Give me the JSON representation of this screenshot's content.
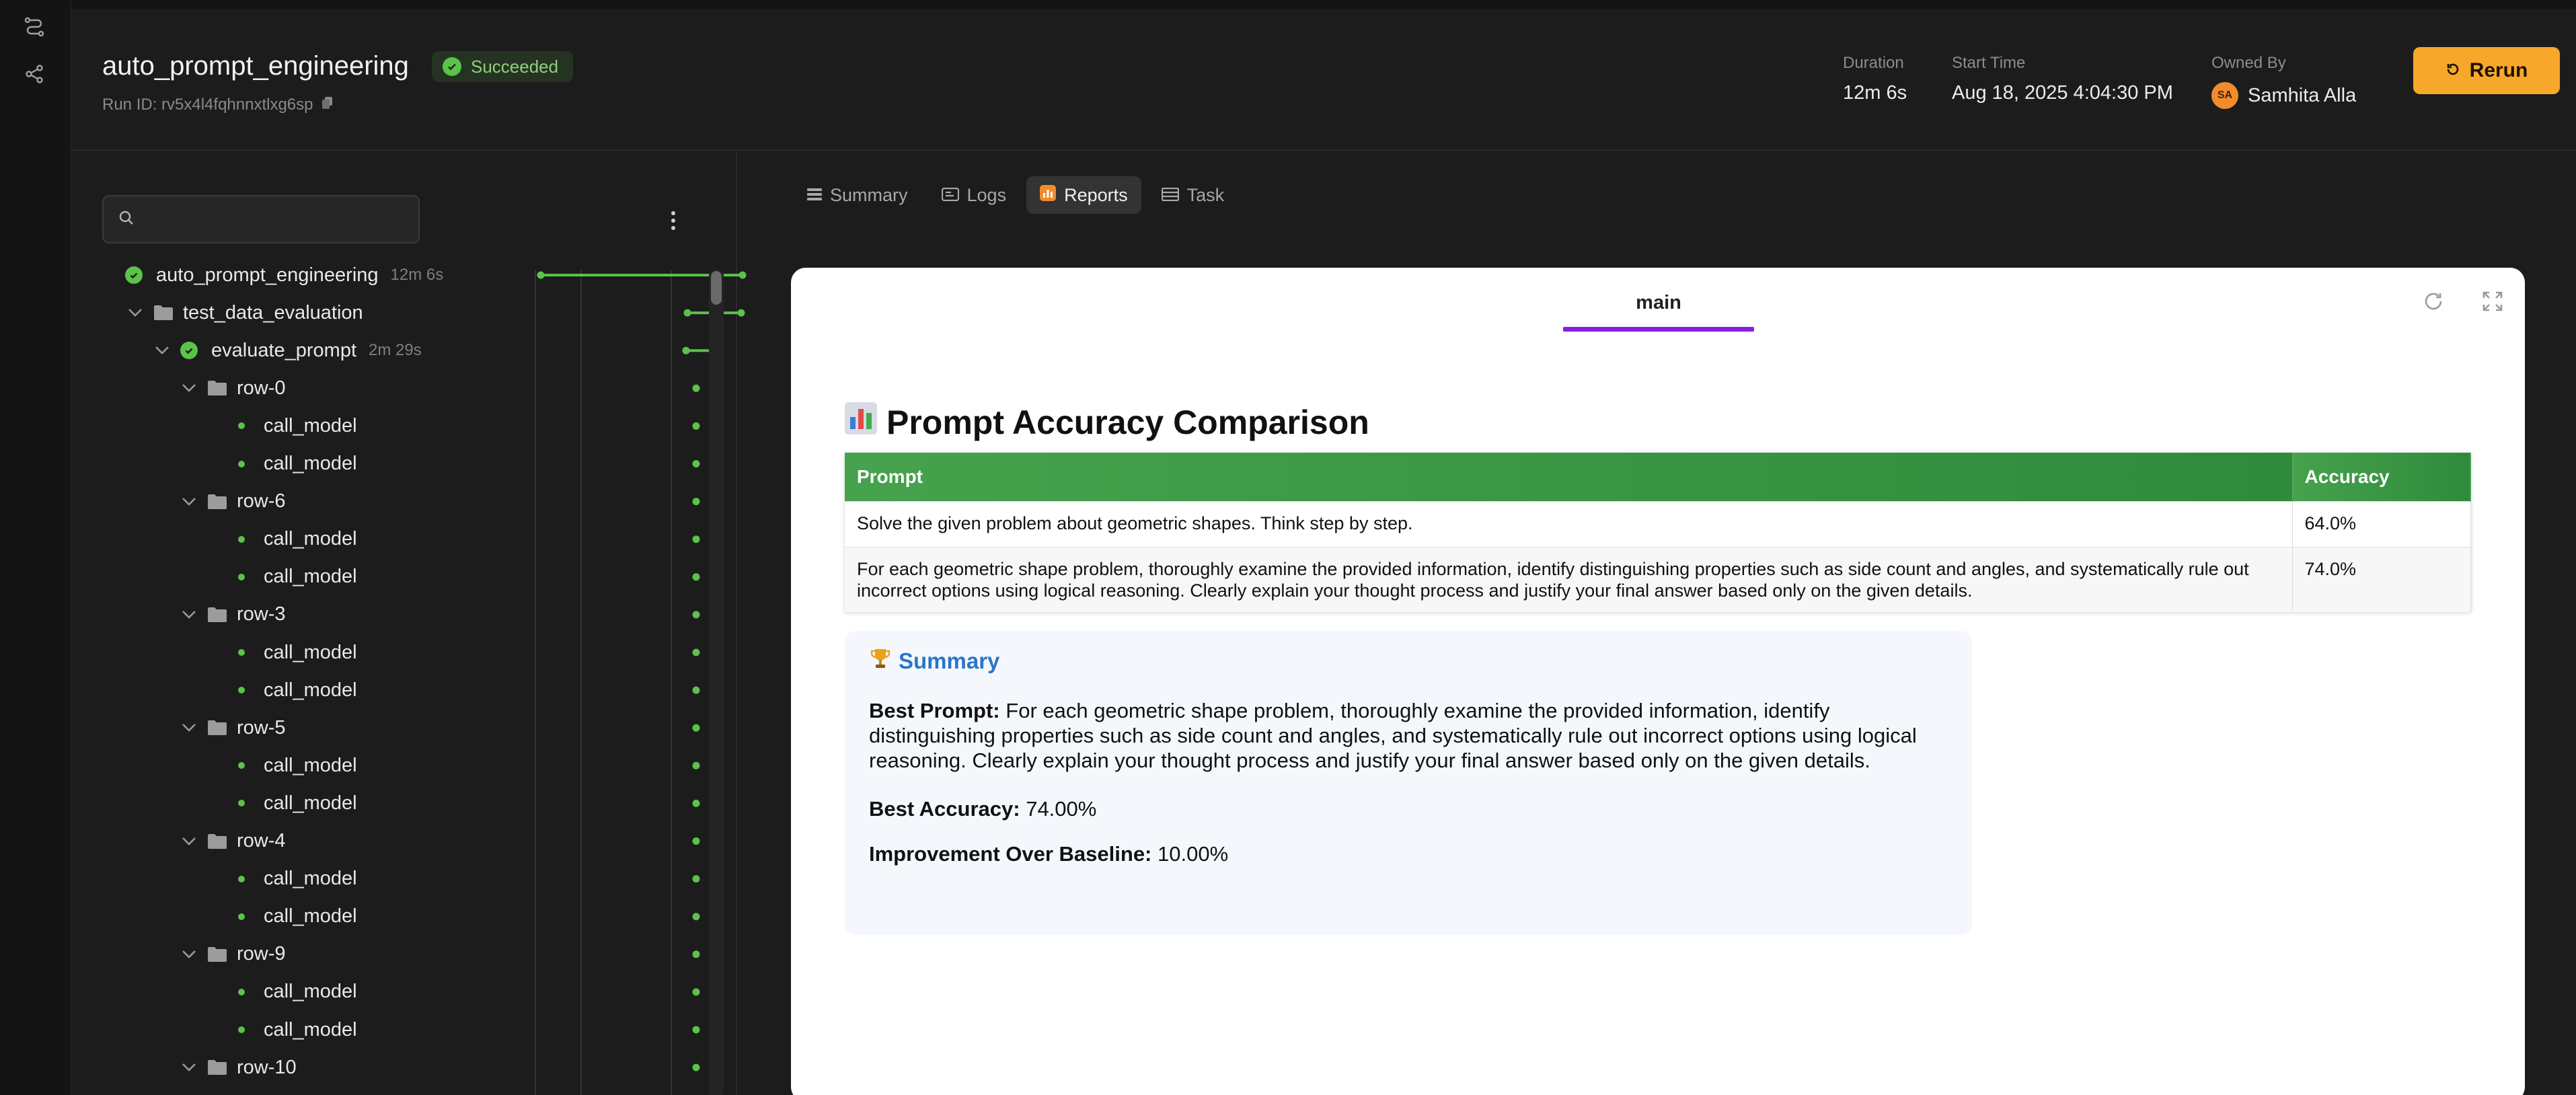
{
  "run": {
    "title": "auto_prompt_engineering",
    "status": "Succeeded",
    "run_id": "Run ID: rv5x4l4fqhnnxtlxg6sp"
  },
  "meta": {
    "duration_label": "Duration",
    "duration_value": "12m 6s",
    "start_label": "Start Time",
    "start_value": "Aug 18, 2025 4:04:30 PM",
    "owner_label": "Owned By",
    "owner_initials": "SA",
    "owner_name": "Samhita Alla"
  },
  "rerun_label": "Rerun",
  "search": {
    "placeholder": ""
  },
  "tree": [
    {
      "name": "auto_prompt_engineering",
      "duration": "12m 6s"
    },
    {
      "name": "test_data_evaluation",
      "duration": ""
    },
    {
      "name": "evaluate_prompt",
      "duration": "2m 29s"
    },
    {
      "name": "row-0"
    },
    {
      "name": "call_model"
    },
    {
      "name": "call_model"
    },
    {
      "name": "row-6"
    },
    {
      "name": "call_model"
    },
    {
      "name": "call_model"
    },
    {
      "name": "row-3"
    },
    {
      "name": "call_model"
    },
    {
      "name": "call_model"
    },
    {
      "name": "row-5"
    },
    {
      "name": "call_model"
    },
    {
      "name": "call_model"
    },
    {
      "name": "row-4"
    },
    {
      "name": "call_model"
    },
    {
      "name": "call_model"
    },
    {
      "name": "row-9"
    },
    {
      "name": "call_model"
    },
    {
      "name": "call_model"
    },
    {
      "name": "row-10"
    }
  ],
  "tabs": {
    "summary": "Summary",
    "logs": "Logs",
    "reports": "Reports",
    "task": "Task"
  },
  "report": {
    "tab": "main",
    "heading": "Prompt Accuracy Comparison",
    "table": {
      "headers": [
        "Prompt",
        "Accuracy"
      ],
      "rows": [
        [
          "Solve the given problem about geometric shapes. Think step by step.",
          "64.0%"
        ],
        [
          "For each geometric shape problem, thoroughly examine the provided information, identify distinguishing properties such as side count and angles, and systematically rule out incorrect options using logical reasoning. Clearly explain your thought process and justify your final answer based only on the given details.",
          "74.0%"
        ]
      ]
    },
    "summary": {
      "title": "Summary",
      "best_prompt_label": "Best Prompt:",
      "best_prompt_value": "For each geometric shape problem, thoroughly examine the provided information, identify distinguishing properties such as side count and angles, and systematically rule out incorrect options using logical reasoning. Clearly explain your thought process and justify your final answer based only on the given details.",
      "best_accuracy_label": "Best Accuracy:",
      "best_accuracy_value": "74.00%",
      "improvement_label": "Improvement Over Baseline:",
      "improvement_value": "10.00%"
    }
  },
  "colors": {
    "accent": "#f7a82a",
    "success": "#5bc24a",
    "report_tab_underline": "#8a1ee0",
    "table_header": "#3b9645",
    "summary_title": "#2a76c8"
  }
}
